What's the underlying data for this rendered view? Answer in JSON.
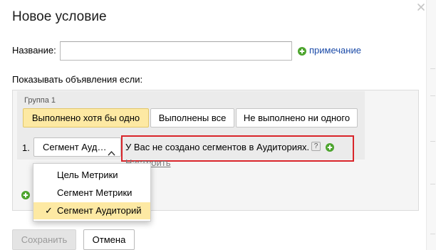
{
  "dialog": {
    "title": "Новое условие"
  },
  "name_field": {
    "label": "Название:",
    "value": "",
    "placeholder": ""
  },
  "note_link": "примечание",
  "show_label": "Показывать объявления если:",
  "group": {
    "title": "Группа 1",
    "match_buttons": [
      {
        "label": "Выполнено хотя бы одно",
        "active": true
      },
      {
        "label": "Выполнены все",
        "active": false
      },
      {
        "label": "Не выполнено ни одного",
        "active": false
      }
    ],
    "rule": {
      "number": "1.",
      "select_value": "Сегмент Ауд…",
      "error_text": "У Вас не создано сегментов в Аудиториях.",
      "help_glyph": "?",
      "setup_link": "Настроить"
    }
  },
  "dropdown": {
    "options": [
      {
        "label": "Цель Метрики",
        "selected": false
      },
      {
        "label": "Сегмент Метрики",
        "selected": false
      },
      {
        "label": "Сегмент Аудиторий",
        "selected": true
      }
    ],
    "check_glyph": "✓"
  },
  "footer": {
    "save_label": "Сохранить",
    "cancel_label": "Отмена"
  },
  "icons": {
    "close": "close-icon",
    "plus": "green-plus-icon",
    "chevron": "chevron-up-icon",
    "help": "help-icon"
  },
  "colors": {
    "accent_yellow": "#fde9a3",
    "link_blue": "#1b4ba8",
    "error_red": "#d9252a",
    "plus_green": "#4ca42d"
  }
}
